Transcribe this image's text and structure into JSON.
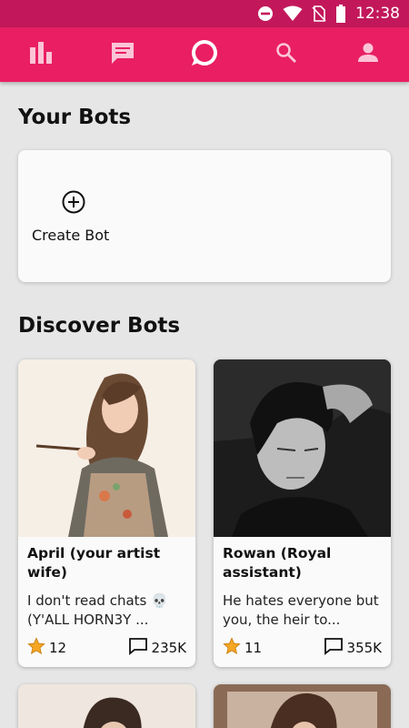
{
  "status_bar": {
    "time": "12:38",
    "icons": [
      "do-not-disturb-icon",
      "wifi-icon",
      "no-sim-icon",
      "battery-icon"
    ]
  },
  "nav": {
    "items": [
      {
        "icon": "bar-chart-icon"
      },
      {
        "icon": "chat-icon"
      },
      {
        "icon": "bubble-icon",
        "active": true
      },
      {
        "icon": "search-icon"
      },
      {
        "icon": "person-icon"
      }
    ]
  },
  "your_bots": {
    "title": "Your Bots",
    "create_label": "Create Bot"
  },
  "discover": {
    "title": "Discover Bots",
    "bots": [
      {
        "name": "April (your artist wife)",
        "description": "I don't read chats 💀(Y'ALL HORN3Y ...",
        "stars": "12",
        "chats": "235K"
      },
      {
        "name": "Rowan (Royal assistant)",
        "description": "He hates everyone but you, the heir to...",
        "stars": "11",
        "chats": "355K"
      }
    ]
  },
  "colors": {
    "status_bar": "#c2185b",
    "nav_bar": "#e91e63",
    "background": "#e6e6e6",
    "star": "#f5a623"
  }
}
